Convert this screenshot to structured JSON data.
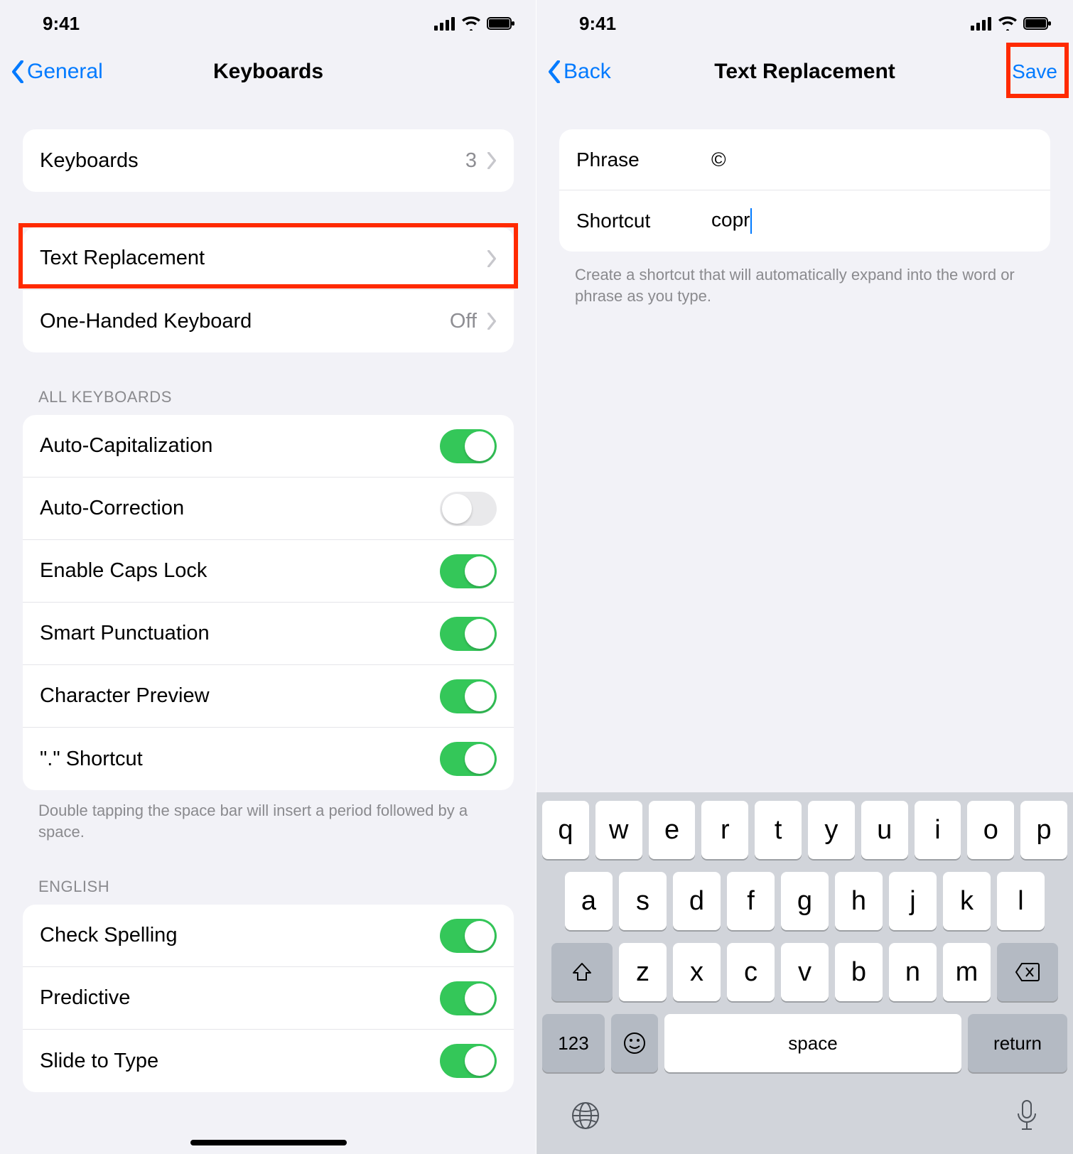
{
  "statusbar": {
    "time": "9:41"
  },
  "left": {
    "nav": {
      "back": "General",
      "title": "Keyboards"
    },
    "group1": {
      "keyboards": {
        "label": "Keyboards",
        "value": "3"
      }
    },
    "group2": {
      "textReplacement": "Text Replacement",
      "oneHanded": {
        "label": "One-Handed Keyboard",
        "value": "Off"
      }
    },
    "header_all": "ALL KEYBOARDS",
    "toggles": {
      "autoCap": "Auto-Capitalization",
      "autoCorr": "Auto-Correction",
      "capsLock": "Enable Caps Lock",
      "smartPunc": "Smart Punctuation",
      "charPreview": "Character Preview",
      "dotShortcut": "\".\" Shortcut"
    },
    "footer_period": "Double tapping the space bar will insert a period followed by a space.",
    "header_english": "ENGLISH",
    "english": {
      "checkSpelling": "Check Spelling",
      "predictive": "Predictive",
      "slideToType": "Slide to Type"
    }
  },
  "right": {
    "nav": {
      "back": "Back",
      "title": "Text Replacement",
      "save": "Save"
    },
    "form": {
      "phraseLabel": "Phrase",
      "phraseValue": "©",
      "shortcutLabel": "Shortcut",
      "shortcutValue": "copr"
    },
    "hint": "Create a shortcut that will automatically expand into the word or phrase as you type.",
    "keyboard": {
      "row1": [
        "q",
        "w",
        "e",
        "r",
        "t",
        "y",
        "u",
        "i",
        "o",
        "p"
      ],
      "row2": [
        "a",
        "s",
        "d",
        "f",
        "g",
        "h",
        "j",
        "k",
        "l"
      ],
      "row3": [
        "z",
        "x",
        "c",
        "v",
        "b",
        "n",
        "m"
      ],
      "n123": "123",
      "space": "space",
      "return": "return"
    }
  }
}
